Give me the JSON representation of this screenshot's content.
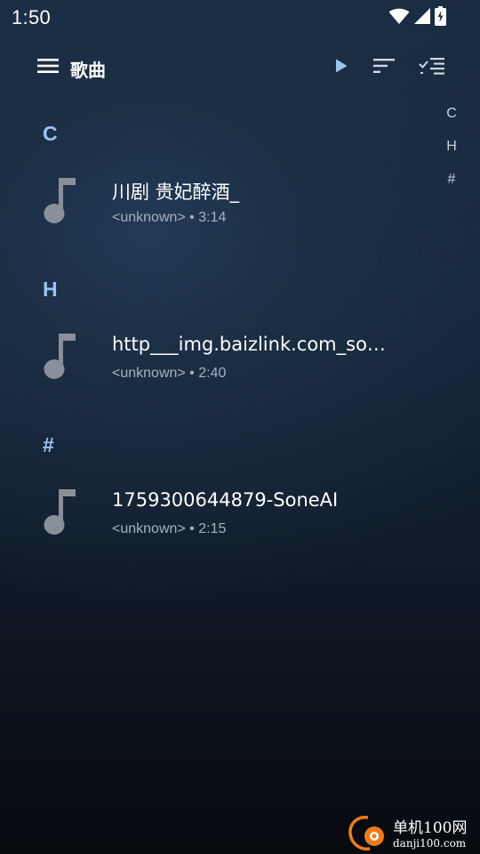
{
  "status_bar": {
    "time": "1:50",
    "icons": [
      "wifi-icon",
      "cell-signal-icon",
      "battery-charging-icon"
    ]
  },
  "toolbar": {
    "title": "歌曲",
    "icons": [
      "menu-icon",
      "play-icon",
      "sort-icon",
      "multi-select-icon"
    ],
    "accent_color": "#9cc3f2"
  },
  "index_bar": {
    "letters": [
      "C",
      "H",
      "#"
    ]
  },
  "sections": [
    {
      "header": "C",
      "songs": [
        {
          "title": "川剧 贵妃醉酒_",
          "subtitle": "<unknown> • 3:14",
          "icon": "music-note-icon"
        }
      ]
    },
    {
      "header": "H",
      "songs": [
        {
          "title": "http___img.baizlink.com_so…",
          "subtitle": "<unknown> • 2:40",
          "icon": "music-note-icon"
        }
      ]
    },
    {
      "header": "#",
      "songs": [
        {
          "title": "1759300644879-SoneAI",
          "subtitle": "<unknown> • 2:15",
          "icon": "music-note-icon"
        }
      ]
    }
  ],
  "watermark": {
    "title": "单机100网",
    "url": "danji100.com"
  }
}
